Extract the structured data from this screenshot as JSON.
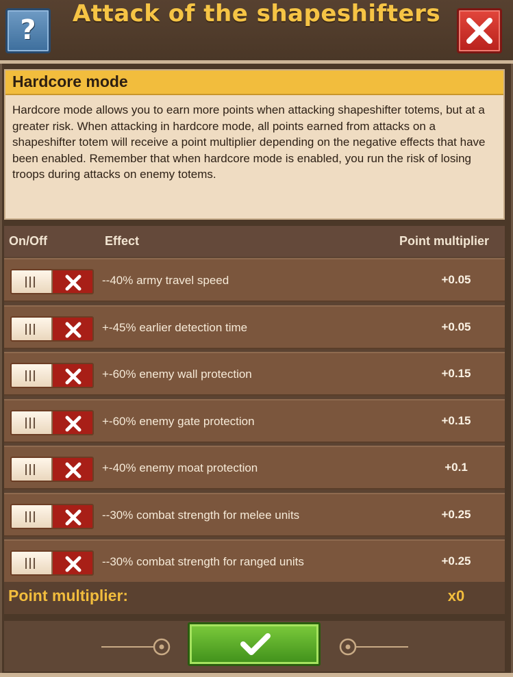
{
  "header": {
    "title": "Attack of the shapeshifters",
    "help_label": "?"
  },
  "info": {
    "heading": "Hardcore mode",
    "text": "Hardcore mode allows you to earn more points when attacking shapeshifter totems, but at a greater risk. When attacking in hardcore mode, all points earned from attacks on a shapeshifter totem will receive a point multiplier depending on the negative effects that have been enabled. Remember that when hardcore mode is enabled, you run the risk of losing troops during attacks on enemy totems."
  },
  "table": {
    "headers": {
      "onoff": "On/Off",
      "effect": "Effect",
      "multiplier": "Point multiplier"
    },
    "rows": [
      {
        "effect": "--40% army travel speed",
        "multiplier": "+0.05",
        "enabled": false
      },
      {
        "effect": "+-45% earlier detection time",
        "multiplier": "+0.05",
        "enabled": false
      },
      {
        "effect": "+-60% enemy wall protection",
        "multiplier": "+0.15",
        "enabled": false
      },
      {
        "effect": "+-60% enemy gate protection",
        "multiplier": "+0.15",
        "enabled": false
      },
      {
        "effect": "+-40% enemy moat protection",
        "multiplier": "+0.1",
        "enabled": false
      },
      {
        "effect": "--30% combat strength for melee units",
        "multiplier": "+0.25",
        "enabled": false
      },
      {
        "effect": "--30% combat strength for ranged units",
        "multiplier": "+0.25",
        "enabled": false
      }
    ]
  },
  "total": {
    "label": "Point multiplier:",
    "value": "x0"
  },
  "colors": {
    "title": "#f6c445",
    "heading_bar": "#f2bd3d",
    "close_button": "#c6251e",
    "help_button": "#4a7db0",
    "confirm_button": "#5cab28",
    "toggle_off": "#a81f17"
  },
  "icons": {
    "help": "question-mark-icon",
    "close": "x-icon",
    "toggle_off": "x-icon",
    "confirm": "checkmark-icon"
  }
}
